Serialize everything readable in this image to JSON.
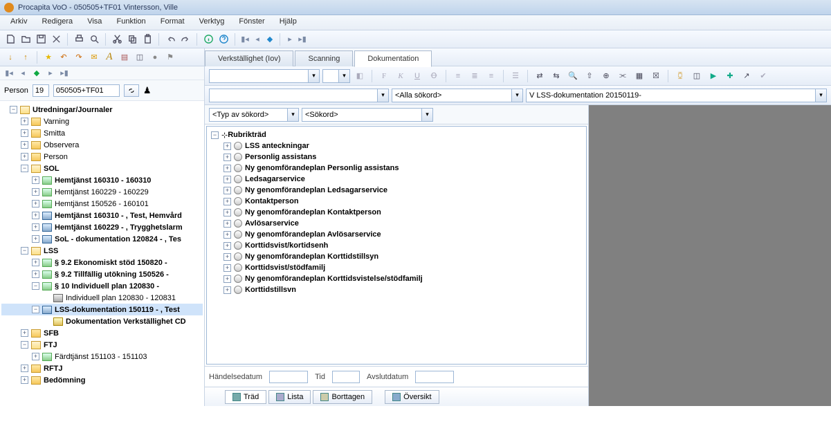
{
  "window": {
    "title": "Procapita VoO - 050505+TF01 Vintersson, Ville"
  },
  "menu": {
    "arkiv": "Arkiv",
    "redigera": "Redigera",
    "visa": "Visa",
    "funktion": "Funktion",
    "format": "Format",
    "verktyg": "Verktyg",
    "fonster": "Fönster",
    "hjalp": "Hjälp"
  },
  "person": {
    "label": "Person",
    "num": "19",
    "id": "050505+TF01"
  },
  "tabs": {
    "verk": "Verkställighet (Iov)",
    "scan": "Scanning",
    "dok": "Dokumentation"
  },
  "filter": {
    "alla": "<Alla sökord>",
    "vlss": "V LSS-dokumentation 20150119-",
    "typ": "<Typ av sökord>",
    "sok": "<Sökord>"
  },
  "rub": {
    "root": "Rubrikträd",
    "items": [
      "LSS anteckningar",
      "Personlig assistans",
      "Ny genomförandeplan Personlig assistans",
      "Ledsagarservice",
      "Ny genomförandeplan Ledsagarservice",
      "Kontaktperson",
      "Ny genomförandeplan Kontaktperson",
      "Avlösarservice",
      "Ny genomförandeplan Avlösarservice",
      "Korttidsvist/kortidsenh",
      "Ny genomförandeplan Korttidstillsyn",
      "Korttidsvist/stödfamilj",
      "Ny genomförandeplan Korttidsvistelse/stödfamilj",
      "Korttidstillsvn"
    ]
  },
  "dates": {
    "handelse": "Händelsedatum",
    "tid": "Tid",
    "avslut": "Avslutdatum"
  },
  "btabs": {
    "trad": "Träd",
    "lista": "Lista",
    "bort": "Borttagen",
    "over": "Översikt"
  },
  "left": {
    "root": "Utredningar/Journaler",
    "varning": "Varning",
    "smitta": "Smitta",
    "obs": "Observera",
    "person": "Person",
    "sol": "SOL",
    "sol_items": [
      "Hemtjänst 160310 - 160310",
      "Hemtjänst 160229 - 160229",
      "Hemtjänst 150526 - 160101",
      "Hemtjänst 160310 - , Test, Hemvård",
      "Hemtjänst 160229 - , Trygghetslarm",
      "SoL - dokumentation 120824 - , Tes"
    ],
    "lss": "LSS",
    "lss_items": [
      "§ 9.2 Ekonomiskt stöd 150820 -",
      "§ 9.2 Tillfällig utökning 150526 -",
      "§ 10 Individuell plan 120830 -",
      "Individuell plan 120830 - 120831",
      "LSS-dokumentation 150119 - , Test",
      "Dokumentation Verkställighet CD"
    ],
    "sfb": "SFB",
    "ftj": "FTJ",
    "ftj1": "Färdtjänst 151103 - 151103",
    "rftj": "RFTJ",
    "bed": "Bedömning"
  }
}
